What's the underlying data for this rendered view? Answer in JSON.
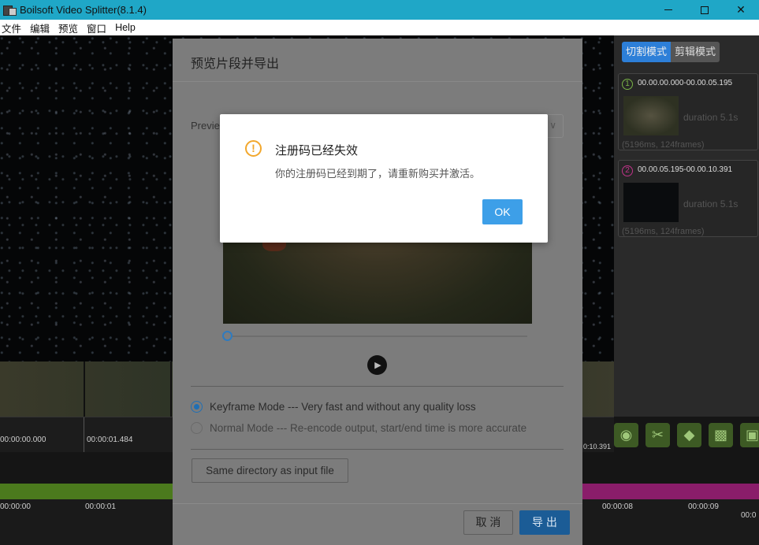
{
  "window": {
    "title": "Boilsoft Video Splitter(8.1.4)",
    "close_glyph": "✕"
  },
  "menu": [
    "文件",
    "编辑",
    "预览",
    "窗口",
    "Help"
  ],
  "right_panel": {
    "tabs": [
      "切割模式",
      "剪辑模式"
    ],
    "segments": [
      {
        "num": "1",
        "time": "00.00.00.000-00.00.05.195",
        "duration": "duration 5.1s",
        "info": "(5196ms, 124frames)",
        "color": "#79b346"
      },
      {
        "num": "2",
        "time": "00.00.05.195-00.00.10.391",
        "duration": "duration 5.1s",
        "info": "(5196ms, 124frames)",
        "color": "#c0338a"
      }
    ],
    "tools": [
      "eye-icon",
      "scissors-icon",
      "tag-icon",
      "trash-icon",
      "puzzle-icon"
    ]
  },
  "timeline": {
    "top_labels": [
      "00:00:00.000",
      "00:00:01.484"
    ],
    "top_right_label": "0:10.391",
    "bottom_labels": [
      "00:00:00",
      "00:00:01",
      "00:00:08",
      "00:00:09",
      "00:0"
    ]
  },
  "export_dialog": {
    "title": "预览片段并导出",
    "preview_label": "Previe",
    "mode_keyframe": "Keyframe Mode --- Very fast and without any quality loss",
    "mode_normal": "Normal Mode --- Re-encode output, start/end time is more accurate",
    "directory_button": "Same directory as input file",
    "cancel": "取 消",
    "export": "导 出"
  },
  "alert": {
    "title": "注册码已经失效",
    "message": "你的注册码已经到期了，请重新购买并激活。",
    "ok": "OK"
  },
  "colors": {
    "titlebar": "#1fa7c7",
    "primary_blue": "#3d9fe8",
    "warning_orange": "#f2a72c"
  }
}
